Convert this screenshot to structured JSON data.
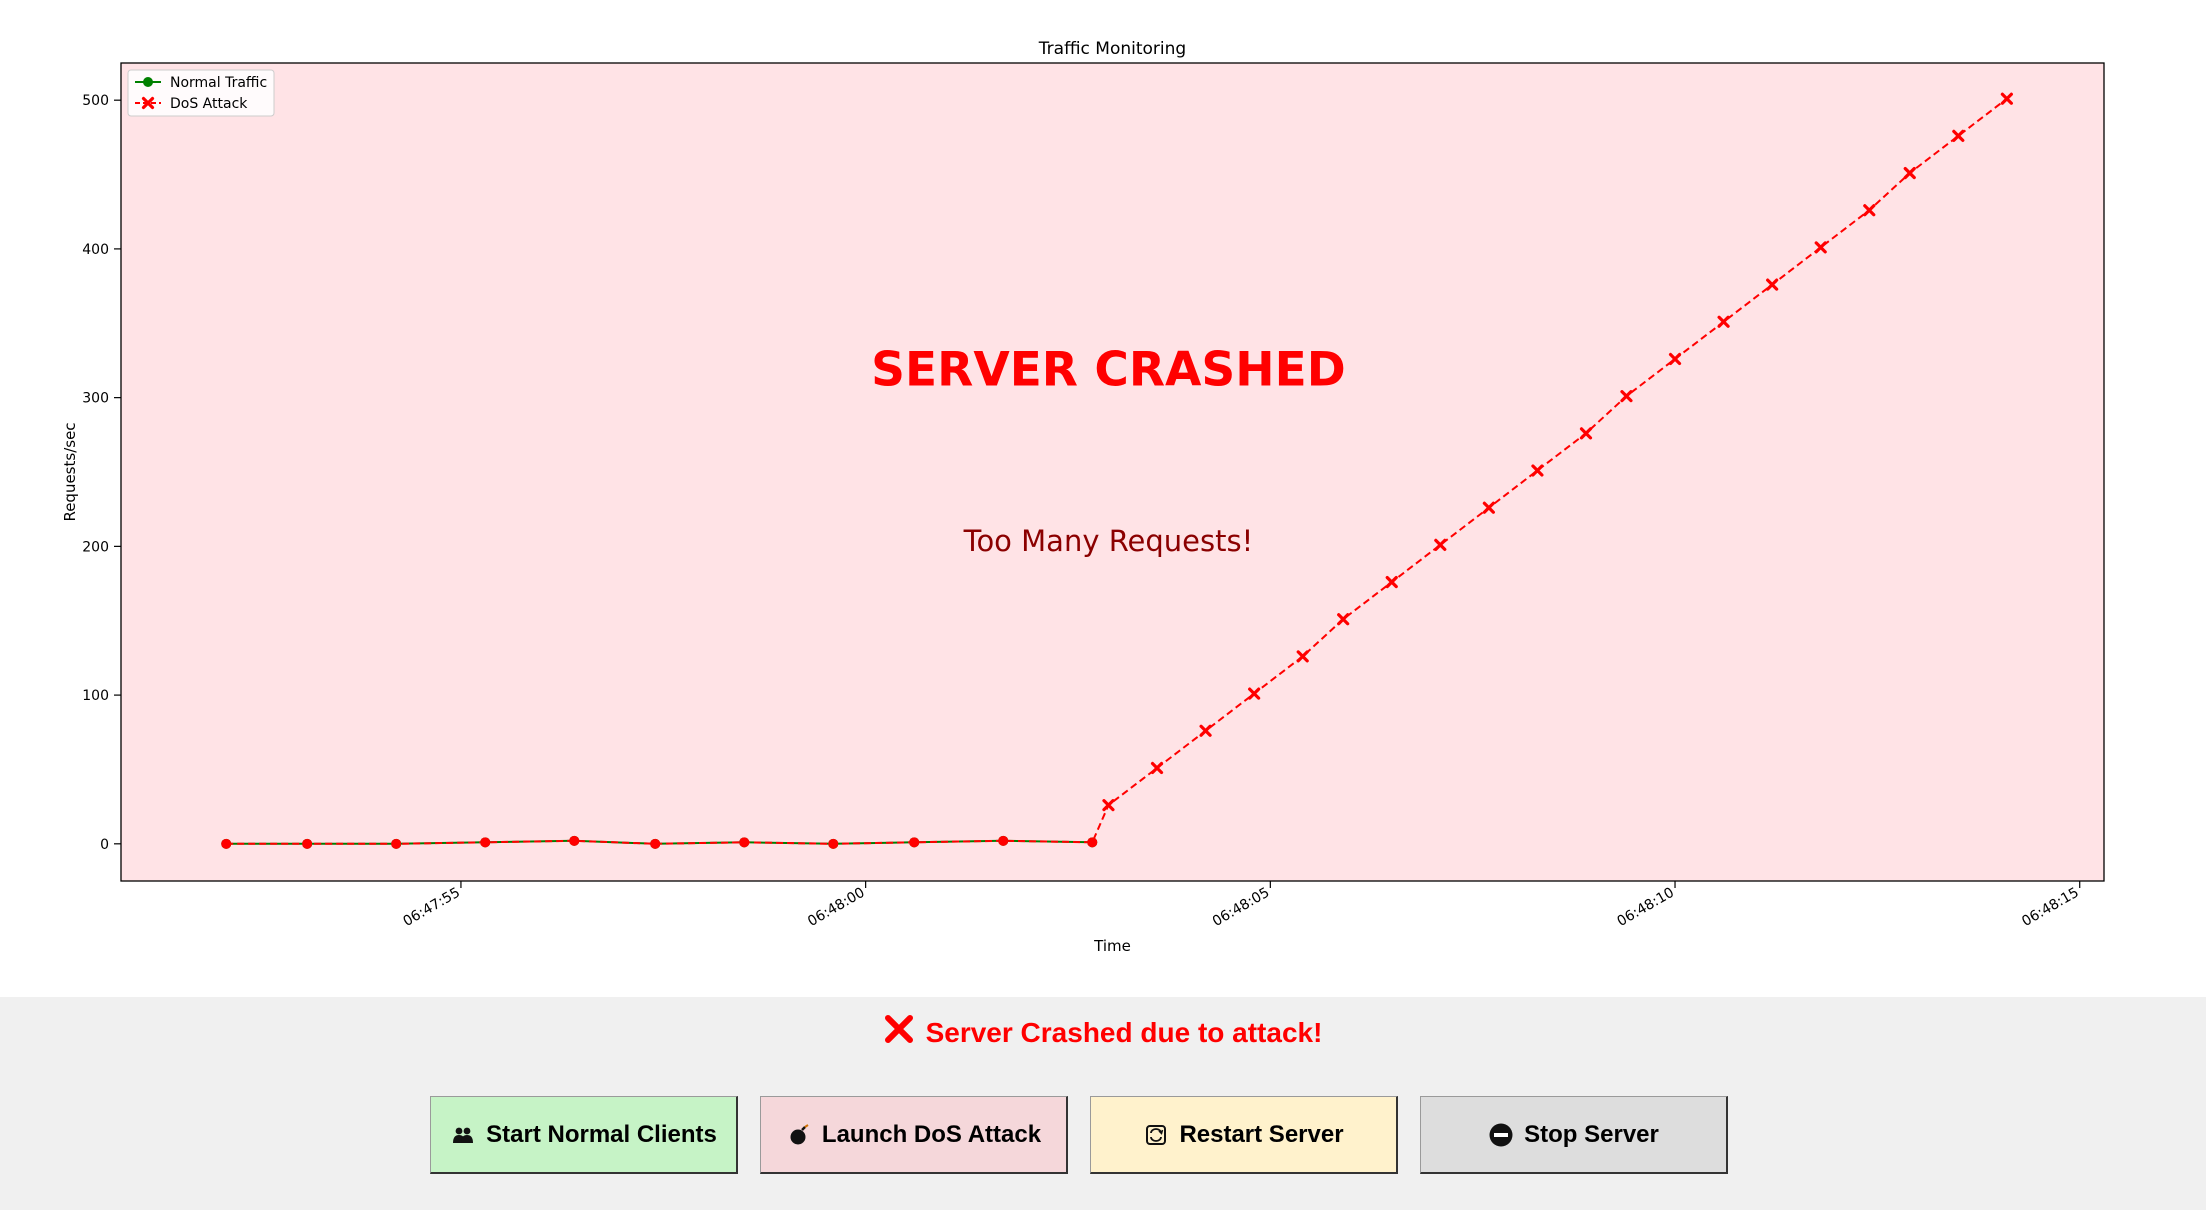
{
  "chart_data": {
    "type": "line",
    "title": "Traffic Monitoring",
    "xlabel": "Time",
    "ylabel": "Requests/sec",
    "x_ticks": [
      "06:47:55",
      "06:48:00",
      "06:48:05",
      "06:48:10",
      "06:48:15"
    ],
    "x_tick_seconds": [
      55,
      60,
      65,
      70,
      75
    ],
    "xlim_seconds": [
      50.8,
      75.3
    ],
    "ylim": [
      -25,
      525
    ],
    "y_ticks": [
      0,
      100,
      200,
      300,
      400,
      500
    ],
    "legend_position": "top-left",
    "grid": false,
    "background_color": "#ffe3e6",
    "series": [
      {
        "name": "Normal Traffic",
        "color": "#008000",
        "marker": "circle",
        "linestyle": "solid",
        "x_seconds": [
          52.1,
          53.1,
          54.2,
          55.3,
          56.4,
          57.4,
          58.5,
          59.6,
          60.6,
          61.7,
          62.8
        ],
        "values": [
          0,
          0,
          0,
          1,
          2,
          0,
          1,
          0,
          1,
          2,
          1
        ]
      },
      {
        "name": "DoS Attack",
        "color": "#ff0000",
        "marker": "x",
        "linestyle": "dashed",
        "x_seconds": [
          52.1,
          53.1,
          54.2,
          55.3,
          56.4,
          57.4,
          58.5,
          59.6,
          60.6,
          61.7,
          62.8,
          63.0,
          63.6,
          64.2,
          64.8,
          65.4,
          65.9,
          66.5,
          67.1,
          67.7,
          68.3,
          68.9,
          69.4,
          70.0,
          70.6,
          71.2,
          71.8,
          72.4,
          72.9,
          73.5,
          74.1
        ],
        "values": [
          0,
          0,
          0,
          1,
          2,
          0,
          1,
          0,
          1,
          2,
          1,
          26,
          51,
          76,
          101,
          126,
          151,
          176,
          201,
          226,
          251,
          276,
          301,
          326,
          351,
          376,
          401,
          426,
          451,
          476,
          501
        ]
      }
    ],
    "annotations": [
      {
        "text": "SERVER CRASHED",
        "x_seconds": 63.0,
        "y": 308,
        "color": "#ff0000",
        "weight": "bold"
      },
      {
        "text": "Too Many Requests!",
        "x_seconds": 63.0,
        "y": 197,
        "color": "#8b0000",
        "weight": "normal"
      }
    ]
  },
  "status": {
    "icon": "cross-mark-icon",
    "text": "Server Crashed due to attack!",
    "color": "#ff0000"
  },
  "buttons": [
    {
      "label": "Start Normal Clients",
      "icon": "users-icon",
      "color": "#c6f3c6"
    },
    {
      "label": "Launch DoS Attack",
      "icon": "bomb-icon",
      "color": "#f5d7da"
    },
    {
      "label": "Restart Server",
      "icon": "restart-icon",
      "color": "#fff2cc"
    },
    {
      "label": "Stop Server",
      "icon": "no-entry-icon",
      "color": "#dddddd"
    }
  ]
}
